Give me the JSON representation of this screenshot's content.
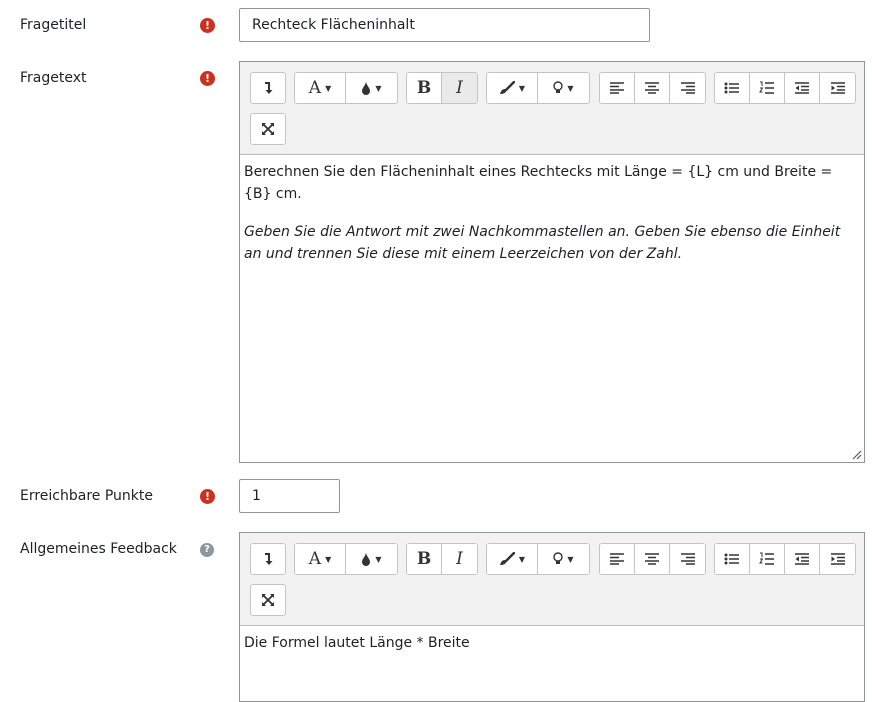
{
  "fields": {
    "fragetitel": {
      "label": "Fragetitel",
      "value": "Rechteck Flächeninhalt"
    },
    "fragetext": {
      "label": "Fragetext",
      "paragraph1": "Berechnen Sie den Flächeninhalt eines Rechtecks mit Länge = {L} cm und Breite = {B} cm.",
      "paragraph2": "Geben Sie die Antwort mit zwei Nachkommastellen an. Geben Sie ebenso die Einheit an und trennen Sie diese mit einem Leerzeichen von der Zahl."
    },
    "punkte": {
      "label": "Erreichbare Punkte",
      "value": "1"
    },
    "feedback": {
      "label": "Allgemeines Feedback",
      "paragraph1": "Die Formel lautet Länge * Breite"
    }
  },
  "toolbar": {
    "font_glyph": "A",
    "bold_glyph": "B",
    "italic_glyph": "I"
  },
  "icons": {
    "required": "!",
    "help": "?"
  },
  "colors": {
    "required": "#ca3120",
    "help": "#8f959e",
    "toolbar_bg": "#f2f2f2"
  }
}
